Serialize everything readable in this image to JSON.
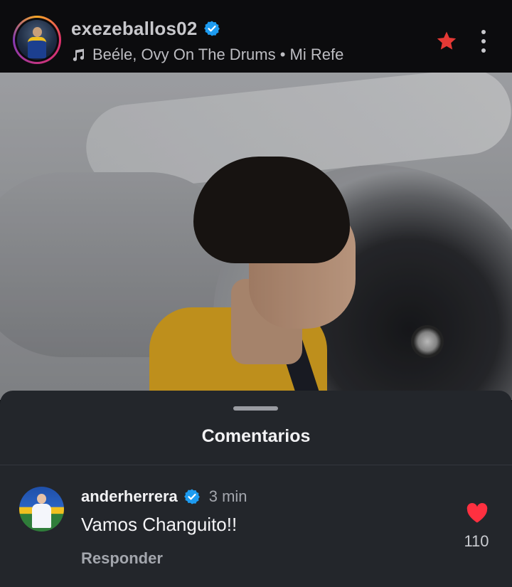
{
  "header": {
    "username": "exezeballos02",
    "music": "Beéle, Ovy On The Drums • Mi Refe",
    "icons": {
      "verified": "verified-badge-icon",
      "music": "music-note-icon",
      "favorite": "star-icon",
      "more": "more-options-icon"
    },
    "colors": {
      "verified": "#1d9bf0",
      "star": "#e53935"
    }
  },
  "sheet": {
    "title": "Comentarios"
  },
  "comments": [
    {
      "username": "anderherrera",
      "time": "3 min",
      "text": "Vamos Changuito!!",
      "reply_label": "Responder",
      "likes": "110",
      "liked": true
    }
  ],
  "colors": {
    "like": "#ff3040",
    "sheet_bg": "#23262b",
    "header_bg": "#0c0c0e"
  }
}
